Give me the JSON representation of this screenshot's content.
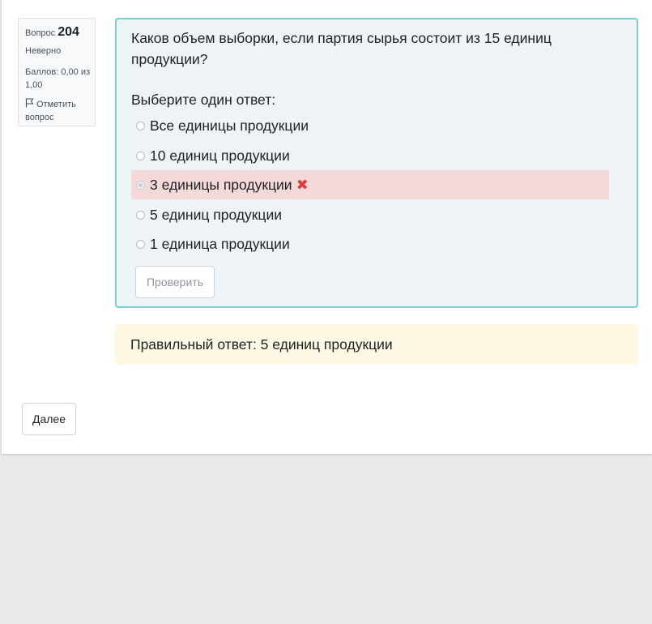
{
  "info": {
    "question_label": "Вопрос",
    "question_number": "204",
    "state": "Неверно",
    "grade": "Баллов: 0,00 из 1,00",
    "flag_label": "Отметить вопрос"
  },
  "question": {
    "text": "Каков объем выборки, если партия сырья состоит из 15 единиц продукции?",
    "prompt": "Выберите один ответ:",
    "answers": [
      {
        "label": "Все единицы продукции",
        "selected": false,
        "incorrect": false
      },
      {
        "label": "10 единиц продукции",
        "selected": false,
        "incorrect": false
      },
      {
        "label": "3 единицы продукции",
        "selected": true,
        "incorrect": true
      },
      {
        "label": "5 единиц продукции",
        "selected": false,
        "incorrect": false
      },
      {
        "label": "1 единица продукции",
        "selected": false,
        "incorrect": false
      }
    ],
    "check_button": "Проверить",
    "incorrect_icon": "cross-icon"
  },
  "feedback": {
    "right_answer": "Правильный ответ: 5 единиц продукции"
  },
  "navigation": {
    "next_button": "Далее"
  },
  "colors": {
    "question_bg": "#edf3f6",
    "question_border": "#7ccbd3",
    "incorrect_bg": "#f5d9d9",
    "incorrect_mark": "#e03b3b",
    "feedback_bg": "#fcf8e3"
  }
}
